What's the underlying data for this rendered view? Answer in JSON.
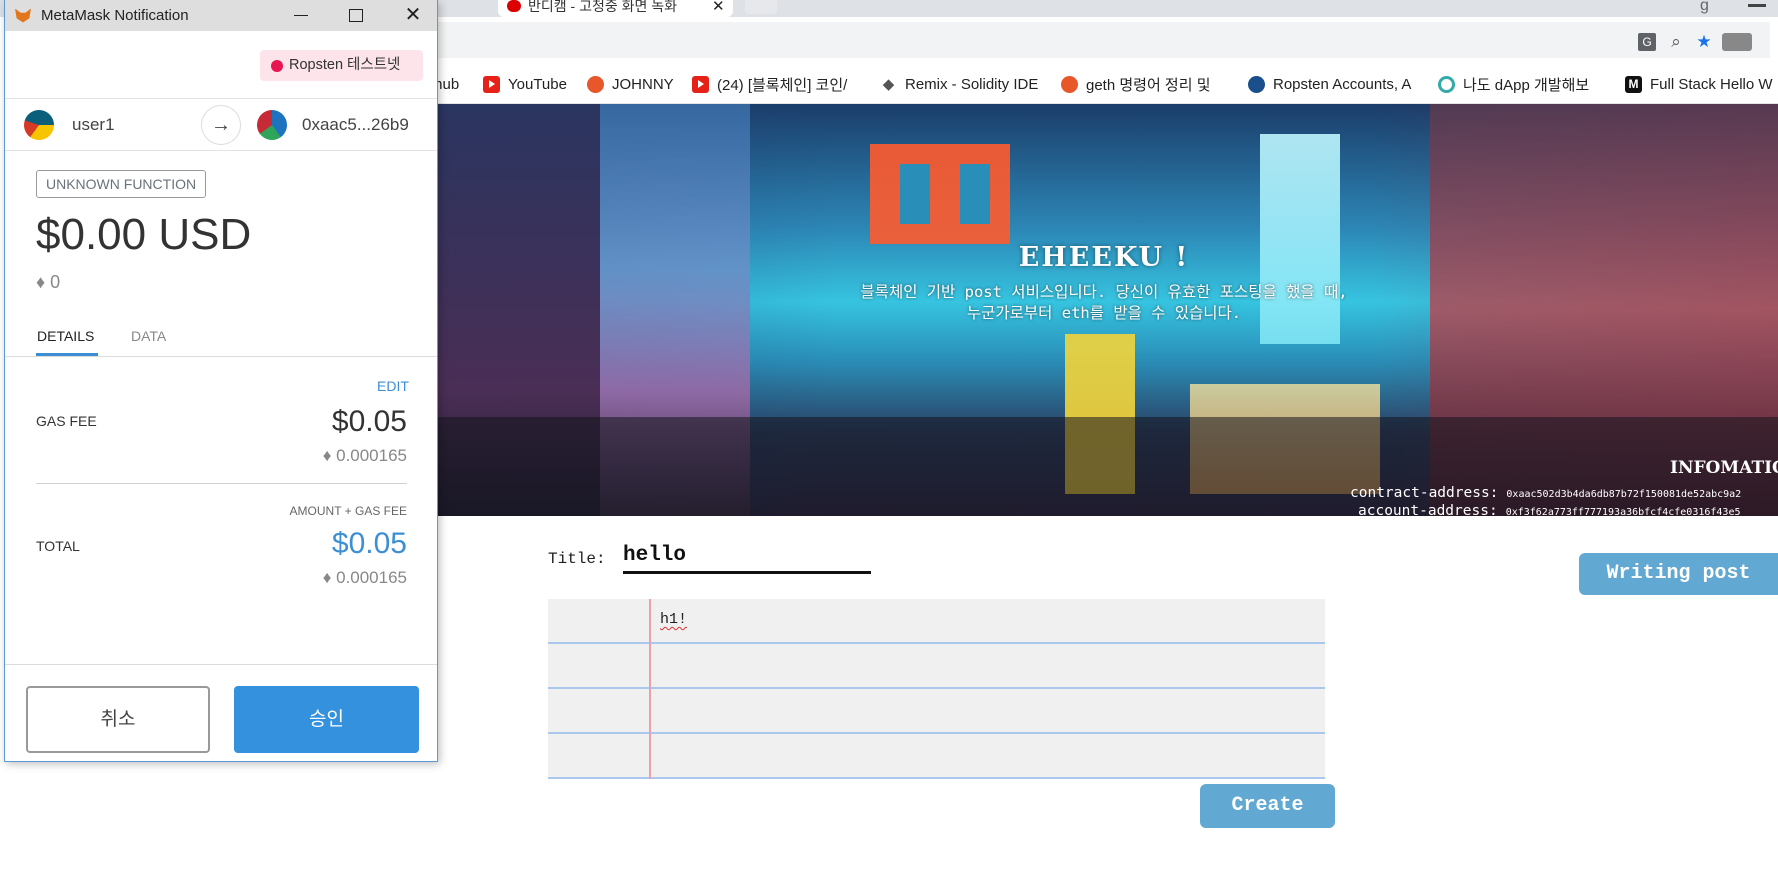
{
  "browser": {
    "tabs": [
      {
        "label": ""
      },
      {
        "label": "반디캠 - 고청중 화면 녹화"
      }
    ],
    "tab_close_glyph": "✕",
    "bookmarks": [
      {
        "label": "thub",
        "icon": "github-icon"
      },
      {
        "label": "YouTube",
        "icon": "youtube-icon"
      },
      {
        "label": "JOHNNY",
        "icon": "gitlab-icon"
      },
      {
        "label": "(24) [블록체인] 코인/",
        "icon": "youtube-icon"
      },
      {
        "label": "Remix - Solidity IDE",
        "icon": "ethereum-icon"
      },
      {
        "label": "geth 명령어 정리 및",
        "icon": "gitlab-icon"
      },
      {
        "label": "Ropsten Accounts, A",
        "icon": "etherscan-icon"
      },
      {
        "label": "나도 dApp 개발해보",
        "icon": "link-icon"
      },
      {
        "label": "Full Stack Hello W",
        "icon": "medium-icon"
      }
    ]
  },
  "page": {
    "hero": {
      "title": "EHEEKU !",
      "subtitle_line1": "블록체인 기반 post 서비스입니다. 당신이 유효한 포스팅을 했을 때,",
      "subtitle_line2": "누군가로부터 eth를 받을 수 있습니다."
    },
    "info": {
      "title": "INFOMATIO",
      "contract_label": "contract-address:",
      "contract_value": "0xaac502d3b4da6db87b72f150081de52abc9a2",
      "account_label": "account-address:",
      "account_value": "0xf3f62a773ff777193a36bfcf4cfe0316f43e5"
    },
    "form": {
      "title_label": "Title:",
      "title_value": "hello",
      "body_text": "h1!",
      "create_label": "Create",
      "writing_label": "Writing post"
    }
  },
  "metamask": {
    "window_title": "MetaMask Notification",
    "network": "Ropsten 테스트넷",
    "from_account": "user1",
    "to_account": "0xaac5...26b9",
    "function_label": "UNKNOWN FUNCTION",
    "usd_amount": "$0.00 USD",
    "eth_amount": "♦ 0",
    "tabs": {
      "details": "DETAILS",
      "data": "DATA"
    },
    "edit_label": "EDIT",
    "gas_fee_label": "GAS FEE",
    "gas_fee_usd": "$0.05",
    "gas_fee_eth": "♦ 0.000165",
    "amount_gas_label": "AMOUNT + GAS FEE",
    "total_label": "TOTAL",
    "total_usd": "$0.05",
    "total_eth": "♦ 0.000165",
    "cancel_label": "취소",
    "approve_label": "승인"
  },
  "colors": {
    "accent_blue": "#3491dd",
    "page_button": "#61a8d2",
    "network_dot": "#e91550"
  }
}
